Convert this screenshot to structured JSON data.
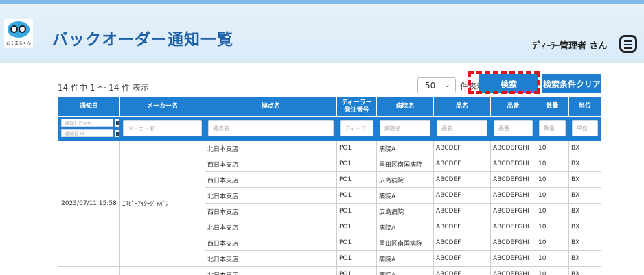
{
  "header": {
    "logo_text": "おくまるくん",
    "title": "バックオーダー通知一覧",
    "user": "ﾃﾞｨｰﾗｰ管理者 さん",
    "menu_icon": "hamburger-menu-icon"
  },
  "toolbar": {
    "count_text": "14 件中 1 〜 14 件 表示",
    "per_page_value": "50",
    "per_page_label": "件表示",
    "search_label": "検索",
    "clear_label": "検索条件クリア",
    "highlight_color": "#e2121b",
    "accent_color": "#1e7fd2"
  },
  "table": {
    "columns": [
      "通知日",
      "メーカー名",
      "拠点名",
      "ディーラー\n発注番号",
      "病院名",
      "品名",
      "品番",
      "数量",
      "単位"
    ],
    "filters": {
      "date_from_placeholder": "通知日From",
      "date_to_placeholder": "通知日To",
      "maker": "メーカー名",
      "branch": "拠点名",
      "dealer": "ディーラ",
      "hospital": "病院名",
      "product": "品名",
      "part": "品番",
      "qty": "数量",
      "unit": "単位"
    },
    "group": {
      "date": "2023/07/11 15:58",
      "maker": "ｴｽﾋﾞｰｱｲｼｰｼﾞｬﾊﾟﾝ"
    },
    "rows": [
      {
        "branch": "北日本支店",
        "dealer": "PO1",
        "hospital": "病院A",
        "product": "ABCDEF",
        "part": "ABCDEFGHI",
        "qty": "10",
        "unit": "BX"
      },
      {
        "branch": "西日本支店",
        "dealer": "PO1",
        "hospital": "墨田区南国病院",
        "product": "ABCDEF",
        "part": "ABCDEFGHI",
        "qty": "10",
        "unit": "BX"
      },
      {
        "branch": "西日本支店",
        "dealer": "PO1",
        "hospital": "広島病院",
        "product": "ABCDEF",
        "part": "ABCDEFGHI",
        "qty": "10",
        "unit": "BX"
      },
      {
        "branch": "北日本支店",
        "dealer": "PO1",
        "hospital": "病院A",
        "product": "ABCDEF",
        "part": "ABCDEFGHI",
        "qty": "10",
        "unit": "BX"
      },
      {
        "branch": "西日本支店",
        "dealer": "PO1",
        "hospital": "広島病院",
        "product": "ABCDEF",
        "part": "ABCDEFGHI",
        "qty": "10",
        "unit": "BX"
      },
      {
        "branch": "北日本支店",
        "dealer": "PO1",
        "hospital": "病院A",
        "product": "ABCDEF",
        "part": "ABCDEFGHI",
        "qty": "10",
        "unit": "BX"
      },
      {
        "branch": "西日本支店",
        "dealer": "PO1",
        "hospital": "墨田区南国病院",
        "product": "ABCDEF",
        "part": "ABCDEFGHI",
        "qty": "10",
        "unit": "BX"
      },
      {
        "branch": "北日本支店",
        "dealer": "PO1",
        "hospital": "病院A",
        "product": "ABCDEF",
        "part": "ABCDEFGHI",
        "qty": "10",
        "unit": "BX"
      },
      {
        "branch": "北日本支店",
        "dealer": "PO1",
        "hospital": "病院A",
        "product": "ABCDEF",
        "part": "ABCDEFGHI",
        "qty": "10",
        "unit": "BX"
      }
    ]
  }
}
